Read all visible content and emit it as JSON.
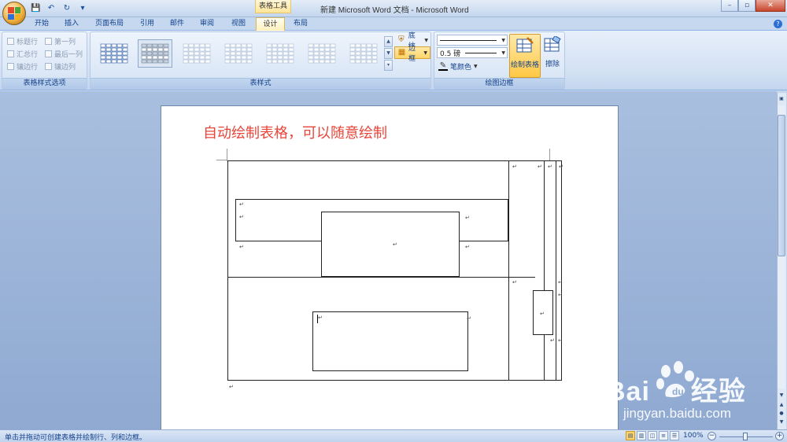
{
  "window": {
    "title": "新建 Microsoft Word 文档 - Microsoft Word",
    "context_tab_title": "表格工具",
    "controls": {
      "minimize": "–",
      "maximize": "▫",
      "close": "✕"
    }
  },
  "qat": {
    "save_icon": "floppy-disk",
    "undo_icon": "undo-arrow",
    "redo_icon": "redo-arrow"
  },
  "tabs": [
    "开始",
    "插入",
    "页面布局",
    "引用",
    "邮件",
    "审阅",
    "视图",
    "设计",
    "布局"
  ],
  "active_tab": "设计",
  "ribbon": {
    "table_style_options": {
      "label": "表格样式选项",
      "options": [
        "标题行",
        "第一列",
        "汇总行",
        "最后一列",
        "镶边行",
        "镶边列"
      ]
    },
    "table_styles": {
      "label": "表样式",
      "shading_label": "底纹",
      "borders_label": "边框"
    },
    "draw_borders": {
      "label": "绘图边框",
      "line_weight": "0.5 磅",
      "pen_color_label": "笔颜色",
      "draw_table_label": "绘制表格",
      "eraser_label": "擦除"
    }
  },
  "document": {
    "heading": "自动绘制表格，可以随意绘制",
    "paragraph_mark": "↵",
    "heading_color": "#e8453a"
  },
  "statusbar": {
    "text": "单击并拖动可创建表格并绘制行、列和边框。",
    "zoom": "100%"
  },
  "watermark": {
    "brand": "Bai百度经验",
    "brand_main": "Bai",
    "brand_cn": "经验",
    "url": "jingyan.baidu.com"
  }
}
